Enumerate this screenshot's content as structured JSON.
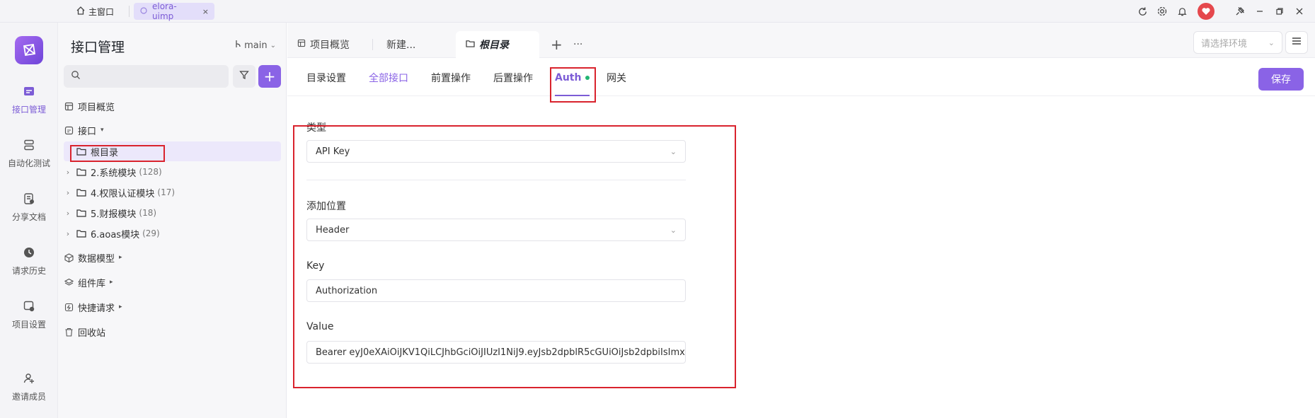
{
  "titlebar": {
    "home_label": "主窗口",
    "tab_label": "elora-uimp",
    "tab_close": "×"
  },
  "rail": {
    "items": [
      {
        "label": "接口管理",
        "icon": "api-icon",
        "active": true
      },
      {
        "label": "自动化测试",
        "icon": "automation-icon",
        "active": false
      },
      {
        "label": "分享文档",
        "icon": "share-doc-icon",
        "active": false
      },
      {
        "label": "请求历史",
        "icon": "history-icon",
        "active": false
      },
      {
        "label": "项目设置",
        "icon": "project-settings-icon",
        "active": false
      },
      {
        "label": "邀请成员",
        "icon": "invite-member-icon",
        "active": false
      }
    ]
  },
  "sidebar": {
    "title": "接口管理",
    "branch": "main",
    "search_placeholder": "",
    "tree": [
      {
        "label": "项目概览",
        "icon": "overview-icon"
      },
      {
        "label": "接口",
        "icon": "api-icon",
        "caret": "▾"
      },
      {
        "label": "根目录",
        "icon": "folder-icon",
        "selected": true
      },
      {
        "label": "2.系统模块",
        "count": "(128)",
        "icon": "folder-icon"
      },
      {
        "label": "4.权限认证模块",
        "count": "(17)",
        "icon": "folder-icon"
      },
      {
        "label": "5.财报模块",
        "count": "(18)",
        "icon": "folder-icon"
      },
      {
        "label": "6.aoas模块",
        "count": "(29)",
        "icon": "folder-icon"
      },
      {
        "label": "数据模型",
        "icon": "cube-icon",
        "caret": "▸"
      },
      {
        "label": "组件库",
        "icon": "layers-icon",
        "caret": "▸"
      },
      {
        "label": "快捷请求",
        "icon": "quick-request-icon",
        "caret": "▸"
      },
      {
        "label": "回收站",
        "icon": "trash-icon"
      }
    ]
  },
  "main_tabs": {
    "items": [
      {
        "label": "项目概览"
      },
      {
        "label": "新建..."
      },
      {
        "label": "根目录",
        "active": true
      }
    ],
    "add": "+",
    "more": "···",
    "env_placeholder": "请选择环境"
  },
  "subtabs": {
    "items": [
      {
        "label": "目录设置"
      },
      {
        "label": "全部接口"
      },
      {
        "label": "前置操作"
      },
      {
        "label": "后置操作"
      },
      {
        "label": "Auth"
      },
      {
        "label": "网关"
      }
    ],
    "save": "保存"
  },
  "form": {
    "type_label": "类型",
    "type_value": "API Key",
    "position_label": "添加位置",
    "position_value": "Header",
    "key_label": "Key",
    "key_value": "Authorization",
    "value_label": "Value",
    "value_value": "Bearer eyJ0eXAiOiJKV1QiLCJhbGciOiJIUzI1NiJ9.eyJsb2dpblR5cGUiOiJsb2dpbiIsImxv"
  },
  "colors": {
    "accent": "#8a63e6",
    "highlight": "#d9232d",
    "status_dot": "#22b573"
  }
}
